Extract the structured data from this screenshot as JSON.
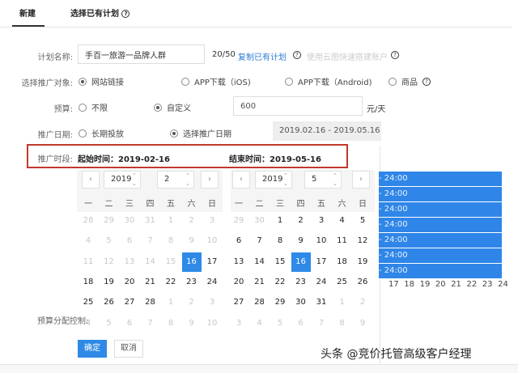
{
  "tabs": [
    {
      "label": "新建"
    },
    {
      "label": "选择已有计划"
    }
  ],
  "form": {
    "plan_name_label": "计划名称:",
    "plan_name_value": "手百一旅游一品牌人群",
    "plan_name_count": "20/50",
    "copy_link": "复制已有计划",
    "cloud_link": "使用云图快速搭建账户",
    "target_label": "选择推广对象:",
    "targets": [
      "网站链接",
      "APP下载（iOS)",
      "APP下载（Android)",
      "商品"
    ],
    "budget_label": "预算:",
    "budget_options": [
      "不限",
      "自定义"
    ],
    "budget_value": "600",
    "budget_unit": "元/天",
    "date_label": "推广日期:",
    "date_options": [
      "长期投放",
      "选择推广日期"
    ],
    "date_range": "2019.02.16 - 2019.05.16",
    "period_label": "推广时段:",
    "start_label": "起始时间：2019-02-16",
    "end_label": "结束时间：2019-05-16",
    "budget_control_label": "预算分配控制:"
  },
  "calendar": {
    "weekdays": [
      "一",
      "二",
      "三",
      "四",
      "五",
      "六",
      "日"
    ],
    "left": {
      "year": "2019",
      "month": "2",
      "days": [
        [
          "28",
          1
        ],
        [
          "29",
          1
        ],
        [
          "30",
          1
        ],
        [
          "31",
          1
        ],
        [
          "1",
          1
        ],
        [
          "2",
          1
        ],
        [
          "3",
          1
        ],
        [
          "4",
          1
        ],
        [
          "5",
          1
        ],
        [
          "6",
          1
        ],
        [
          "7",
          1
        ],
        [
          "8",
          1
        ],
        [
          "9",
          1
        ],
        [
          "10",
          1
        ],
        [
          "11",
          1
        ],
        [
          "12",
          1
        ],
        [
          "13",
          1
        ],
        [
          "14",
          1
        ],
        [
          "15",
          1
        ],
        [
          "16",
          2
        ],
        [
          "17",
          0
        ],
        [
          "18",
          0
        ],
        [
          "19",
          0
        ],
        [
          "20",
          0
        ],
        [
          "21",
          0
        ],
        [
          "22",
          0
        ],
        [
          "23",
          0
        ],
        [
          "24",
          0
        ],
        [
          "25",
          0
        ],
        [
          "26",
          0
        ],
        [
          "27",
          0
        ],
        [
          "28",
          0
        ],
        [
          "1",
          1
        ],
        [
          "2",
          1
        ],
        [
          "3",
          1
        ],
        [
          "4",
          1
        ],
        [
          "5",
          1
        ],
        [
          "6",
          1
        ],
        [
          "7",
          1
        ],
        [
          "8",
          1
        ],
        [
          "9",
          1
        ],
        [
          "10",
          1
        ]
      ]
    },
    "right": {
      "year": "2019",
      "month": "5",
      "days": [
        [
          "29",
          1
        ],
        [
          "30",
          1
        ],
        [
          "1",
          0
        ],
        [
          "2",
          0
        ],
        [
          "3",
          0
        ],
        [
          "4",
          0
        ],
        [
          "5",
          0
        ],
        [
          "6",
          0
        ],
        [
          "7",
          0
        ],
        [
          "8",
          0
        ],
        [
          "9",
          0
        ],
        [
          "10",
          0
        ],
        [
          "11",
          0
        ],
        [
          "12",
          0
        ],
        [
          "13",
          0
        ],
        [
          "14",
          0
        ],
        [
          "15",
          0
        ],
        [
          "16",
          2
        ],
        [
          "17",
          0
        ],
        [
          "18",
          0
        ],
        [
          "19",
          0
        ],
        [
          "20",
          0
        ],
        [
          "21",
          0
        ],
        [
          "22",
          0
        ],
        [
          "23",
          0
        ],
        [
          "24",
          0
        ],
        [
          "25",
          0
        ],
        [
          "26",
          0
        ],
        [
          "27",
          0
        ],
        [
          "28",
          0
        ],
        [
          "29",
          0
        ],
        [
          "30",
          0
        ],
        [
          "31",
          0
        ],
        [
          "1",
          1
        ],
        [
          "2",
          1
        ],
        [
          "3",
          1
        ],
        [
          "4",
          1
        ],
        [
          "5",
          1
        ],
        [
          "6",
          1
        ],
        [
          "7",
          1
        ],
        [
          "8",
          1
        ],
        [
          "9",
          1
        ]
      ]
    },
    "confirm": "确定",
    "cancel": "取消"
  },
  "schedule": {
    "bars": [
      "- 24:00",
      "- 24:00",
      "- 24:00",
      "- 24:00",
      "- 24:00",
      "- 24:00",
      "- 24:00"
    ],
    "hours": [
      "17",
      "18",
      "19",
      "20",
      "21",
      "22",
      "23",
      "24"
    ]
  },
  "watermark": "头条 @竞价托管高级客户经理",
  "colors": {
    "accent": "#2e8ae6",
    "highlight_border": "#c0392b"
  }
}
